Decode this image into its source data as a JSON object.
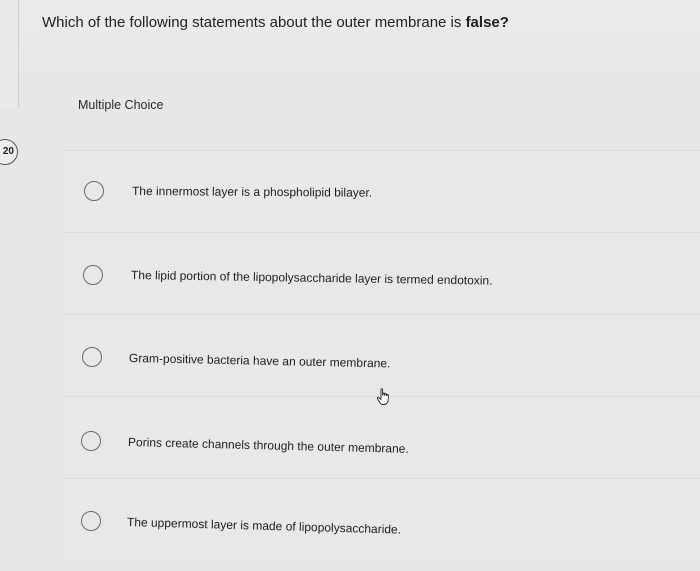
{
  "question": {
    "text": "Which of the following statements about the outer membrane is ",
    "emphasis": "false?"
  },
  "section_label": "Multiple Choice",
  "question_number": "20",
  "choices": [
    {
      "label": "The innermost layer is a phospholipid bilayer."
    },
    {
      "label": "The lipid portion of the lipopolysaccharide layer is termed endotoxin."
    },
    {
      "label": "Gram-positive bacteria have an outer membrane."
    },
    {
      "label": "Porins create channels through the outer membrane."
    },
    {
      "label": "The uppermost layer is made of lipopolysaccharide."
    }
  ],
  "cursor_icon": "hand-pointer-icon"
}
